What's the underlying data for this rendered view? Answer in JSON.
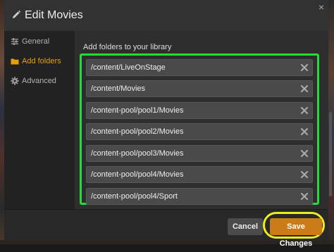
{
  "dialog": {
    "title": "Edit Movies",
    "close_label": "×"
  },
  "sidebar": {
    "items": [
      {
        "label": "General",
        "icon": "settings-sliders-icon",
        "active": false
      },
      {
        "label": "Add folders",
        "icon": "folder-icon",
        "active": true
      },
      {
        "label": "Advanced",
        "icon": "gear-icon",
        "active": false
      }
    ]
  },
  "main": {
    "section_label": "Add folders to your library",
    "folders": [
      "/content/LiveOnStage",
      "/content/Movies",
      "/content-pool/pool1/Movies",
      "/content-pool/pool2/Movies",
      "/content-pool/pool3/Movies",
      "/content-pool/pool4/Movies",
      "/content-pool/pool4/Sport"
    ]
  },
  "footer": {
    "cancel_label": "Cancel",
    "save_label": "Save Changes"
  },
  "colors": {
    "accent": "#e5a00d",
    "save_button": "#cc7b19",
    "folder_highlight": "#22dd33",
    "save_highlight": "#ecec24"
  }
}
